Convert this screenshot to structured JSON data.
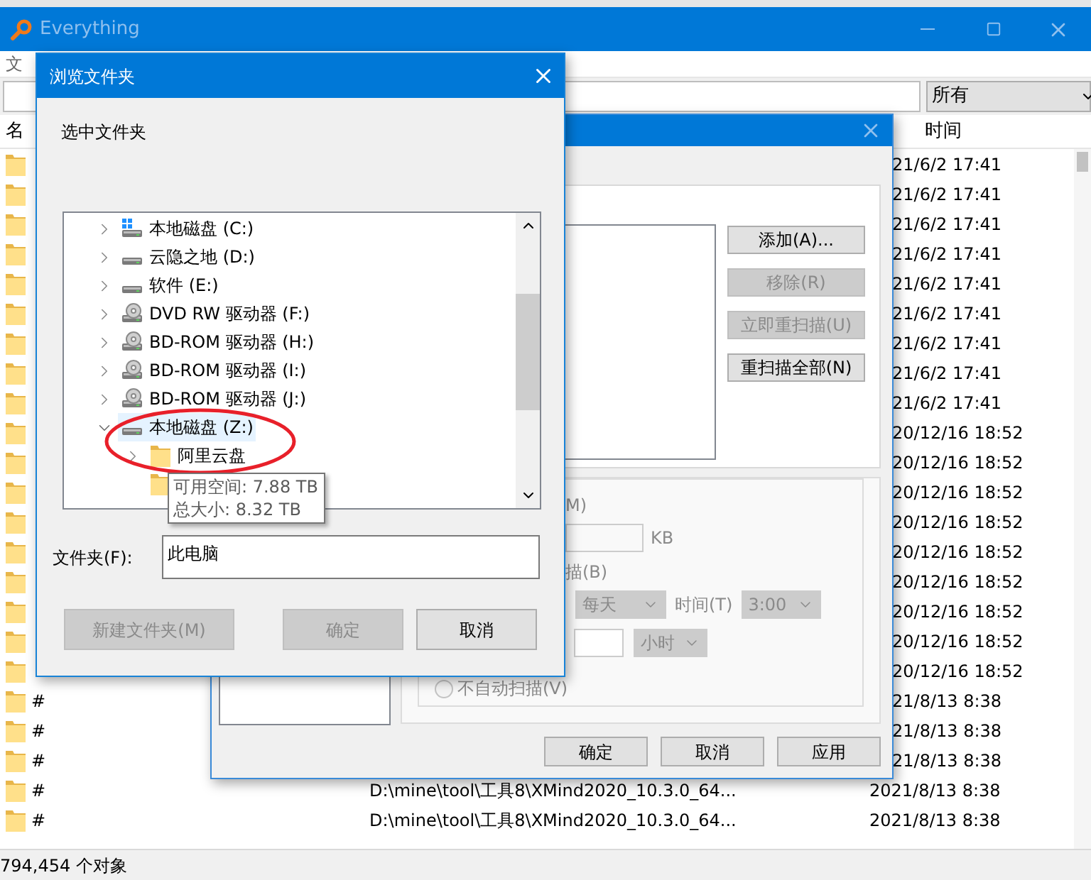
{
  "main_window": {
    "title": "Everything",
    "menu": [
      "文"
    ],
    "filter": "所有",
    "columns": [
      "名",
      "时间"
    ],
    "rows": [
      {
        "modified": "21/6/2 17:41"
      },
      {
        "modified": "21/6/2 17:41"
      },
      {
        "modified": "21/6/2 17:41"
      },
      {
        "modified": "21/6/2 17:41"
      },
      {
        "modified": "21/6/2 17:41"
      },
      {
        "modified": "21/6/2 17:41"
      },
      {
        "modified": "21/6/2 17:41"
      },
      {
        "modified": "21/6/2 17:41"
      },
      {
        "modified": "21/6/2 17:41"
      },
      {
        "modified": "20/12/16 18:52"
      },
      {
        "modified": "20/12/16 18:52"
      },
      {
        "modified": "20/12/16 18:52"
      },
      {
        "modified": "20/12/16 18:52"
      },
      {
        "modified": "20/12/16 18:52"
      },
      {
        "modified": "20/12/16 18:52"
      },
      {
        "modified": "20/12/16 18:52"
      },
      {
        "modified": "20/12/16 18:52"
      },
      {
        "modified": "20/12/16 18:52"
      },
      {
        "name": "#",
        "modified": "21/8/13 8:38"
      },
      {
        "name": "#",
        "modified": "21/8/13 8:38"
      },
      {
        "name": "#",
        "modified": "21/8/13 8:38"
      },
      {
        "name": "#",
        "path": "D:\\mine\\tool\\工具8\\XMind2020_10.3.0_64...",
        "modified": "2021/8/13 8:38"
      },
      {
        "name": "#",
        "path": "D:\\mine\\tool\\工具8\\XMind2020_10.3.0_64...",
        "modified": "2021/8/13 8:38"
      }
    ],
    "status_bar": "794,454 个对象"
  },
  "options_dialog": {
    "side_buttons": [
      {
        "label": "添加(A)...",
        "disabled": false
      },
      {
        "label": "移除(R)",
        "disabled": true
      },
      {
        "label": "立即重扫描(U)",
        "disabled": true
      },
      {
        "label": "重扫描全部(N)",
        "disabled": false
      }
    ],
    "schedule": {
      "disabled": true,
      "size_label": "M)",
      "size_unit": "KB",
      "scan_label": "描(B)",
      "frequency": "每天",
      "time_label": "时间(T)",
      "time": "3:00",
      "interval_unit": "小时",
      "no_auto_scan": {
        "label": "不自动扫描(V)",
        "selected": false
      }
    },
    "buttons": [
      "确定",
      "取消",
      "应用"
    ]
  },
  "browse_dialog": {
    "title": "浏览文件夹",
    "prompt": "选中文件夹",
    "tree": [
      {
        "label": "本地磁盘 (C:)",
        "kind": "system",
        "expanded": false,
        "selected": false
      },
      {
        "label": "云隐之地 (D:)",
        "kind": "hdd",
        "expanded": false,
        "selected": false
      },
      {
        "label": "软件 (E:)",
        "kind": "hdd",
        "expanded": false,
        "selected": false
      },
      {
        "label": "DVD RW 驱动器 (F:)",
        "kind": "optical",
        "expanded": false,
        "selected": false
      },
      {
        "label": "BD-ROM 驱动器 (H:)",
        "kind": "optical",
        "expanded": false,
        "selected": false
      },
      {
        "label": "BD-ROM 驱动器 (I:)",
        "kind": "optical",
        "expanded": false,
        "selected": false
      },
      {
        "label": "BD-ROM 驱动器 (J:)",
        "kind": "optical",
        "expanded": false,
        "selected": false
      },
      {
        "label": "本地磁盘 (Z:)",
        "kind": "hdd",
        "expanded": true,
        "selected": true,
        "children": [
          {
            "label": "阿里云盘",
            "kind": "folder",
            "expanded": false,
            "selected": false
          },
          {
            "kind": "folder",
            "selected": false
          }
        ]
      }
    ],
    "tooltip": [
      "可用空间: 7.88 TB",
      "总大小: 8.32 TB"
    ],
    "folder_label": "文件夹(F):",
    "folder_value": "此电脑",
    "buttons": [
      {
        "label": "新建文件夹(M)",
        "disabled": true
      },
      {
        "label": "确定",
        "disabled": true
      },
      {
        "label": "取消",
        "disabled": false
      }
    ]
  }
}
